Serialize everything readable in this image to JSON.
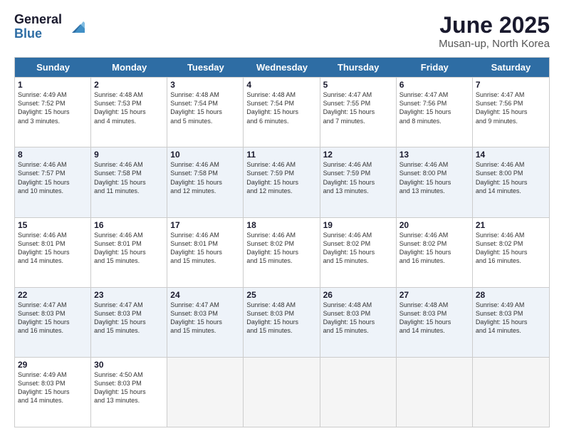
{
  "logo": {
    "general": "General",
    "blue": "Blue"
  },
  "title": "June 2025",
  "location": "Musan-up, North Korea",
  "days": [
    "Sunday",
    "Monday",
    "Tuesday",
    "Wednesday",
    "Thursday",
    "Friday",
    "Saturday"
  ],
  "rows": [
    [
      {
        "day": "1",
        "lines": [
          "Sunrise: 4:49 AM",
          "Sunset: 7:52 PM",
          "Daylight: 15 hours",
          "and 3 minutes."
        ]
      },
      {
        "day": "2",
        "lines": [
          "Sunrise: 4:48 AM",
          "Sunset: 7:53 PM",
          "Daylight: 15 hours",
          "and 4 minutes."
        ]
      },
      {
        "day": "3",
        "lines": [
          "Sunrise: 4:48 AM",
          "Sunset: 7:54 PM",
          "Daylight: 15 hours",
          "and 5 minutes."
        ]
      },
      {
        "day": "4",
        "lines": [
          "Sunrise: 4:48 AM",
          "Sunset: 7:54 PM",
          "Daylight: 15 hours",
          "and 6 minutes."
        ]
      },
      {
        "day": "5",
        "lines": [
          "Sunrise: 4:47 AM",
          "Sunset: 7:55 PM",
          "Daylight: 15 hours",
          "and 7 minutes."
        ]
      },
      {
        "day": "6",
        "lines": [
          "Sunrise: 4:47 AM",
          "Sunset: 7:56 PM",
          "Daylight: 15 hours",
          "and 8 minutes."
        ]
      },
      {
        "day": "7",
        "lines": [
          "Sunrise: 4:47 AM",
          "Sunset: 7:56 PM",
          "Daylight: 15 hours",
          "and 9 minutes."
        ]
      }
    ],
    [
      {
        "day": "8",
        "lines": [
          "Sunrise: 4:46 AM",
          "Sunset: 7:57 PM",
          "Daylight: 15 hours",
          "and 10 minutes."
        ]
      },
      {
        "day": "9",
        "lines": [
          "Sunrise: 4:46 AM",
          "Sunset: 7:58 PM",
          "Daylight: 15 hours",
          "and 11 minutes."
        ]
      },
      {
        "day": "10",
        "lines": [
          "Sunrise: 4:46 AM",
          "Sunset: 7:58 PM",
          "Daylight: 15 hours",
          "and 12 minutes."
        ]
      },
      {
        "day": "11",
        "lines": [
          "Sunrise: 4:46 AM",
          "Sunset: 7:59 PM",
          "Daylight: 15 hours",
          "and 12 minutes."
        ]
      },
      {
        "day": "12",
        "lines": [
          "Sunrise: 4:46 AM",
          "Sunset: 7:59 PM",
          "Daylight: 15 hours",
          "and 13 minutes."
        ]
      },
      {
        "day": "13",
        "lines": [
          "Sunrise: 4:46 AM",
          "Sunset: 8:00 PM",
          "Daylight: 15 hours",
          "and 13 minutes."
        ]
      },
      {
        "day": "14",
        "lines": [
          "Sunrise: 4:46 AM",
          "Sunset: 8:00 PM",
          "Daylight: 15 hours",
          "and 14 minutes."
        ]
      }
    ],
    [
      {
        "day": "15",
        "lines": [
          "Sunrise: 4:46 AM",
          "Sunset: 8:01 PM",
          "Daylight: 15 hours",
          "and 14 minutes."
        ]
      },
      {
        "day": "16",
        "lines": [
          "Sunrise: 4:46 AM",
          "Sunset: 8:01 PM",
          "Daylight: 15 hours",
          "and 15 minutes."
        ]
      },
      {
        "day": "17",
        "lines": [
          "Sunrise: 4:46 AM",
          "Sunset: 8:01 PM",
          "Daylight: 15 hours",
          "and 15 minutes."
        ]
      },
      {
        "day": "18",
        "lines": [
          "Sunrise: 4:46 AM",
          "Sunset: 8:02 PM",
          "Daylight: 15 hours",
          "and 15 minutes."
        ]
      },
      {
        "day": "19",
        "lines": [
          "Sunrise: 4:46 AM",
          "Sunset: 8:02 PM",
          "Daylight: 15 hours",
          "and 15 minutes."
        ]
      },
      {
        "day": "20",
        "lines": [
          "Sunrise: 4:46 AM",
          "Sunset: 8:02 PM",
          "Daylight: 15 hours",
          "and 16 minutes."
        ]
      },
      {
        "day": "21",
        "lines": [
          "Sunrise: 4:46 AM",
          "Sunset: 8:02 PM",
          "Daylight: 15 hours",
          "and 16 minutes."
        ]
      }
    ],
    [
      {
        "day": "22",
        "lines": [
          "Sunrise: 4:47 AM",
          "Sunset: 8:03 PM",
          "Daylight: 15 hours",
          "and 16 minutes."
        ]
      },
      {
        "day": "23",
        "lines": [
          "Sunrise: 4:47 AM",
          "Sunset: 8:03 PM",
          "Daylight: 15 hours",
          "and 15 minutes."
        ]
      },
      {
        "day": "24",
        "lines": [
          "Sunrise: 4:47 AM",
          "Sunset: 8:03 PM",
          "Daylight: 15 hours",
          "and 15 minutes."
        ]
      },
      {
        "day": "25",
        "lines": [
          "Sunrise: 4:48 AM",
          "Sunset: 8:03 PM",
          "Daylight: 15 hours",
          "and 15 minutes."
        ]
      },
      {
        "day": "26",
        "lines": [
          "Sunrise: 4:48 AM",
          "Sunset: 8:03 PM",
          "Daylight: 15 hours",
          "and 15 minutes."
        ]
      },
      {
        "day": "27",
        "lines": [
          "Sunrise: 4:48 AM",
          "Sunset: 8:03 PM",
          "Daylight: 15 hours",
          "and 14 minutes."
        ]
      },
      {
        "day": "28",
        "lines": [
          "Sunrise: 4:49 AM",
          "Sunset: 8:03 PM",
          "Daylight: 15 hours",
          "and 14 minutes."
        ]
      }
    ],
    [
      {
        "day": "29",
        "lines": [
          "Sunrise: 4:49 AM",
          "Sunset: 8:03 PM",
          "Daylight: 15 hours",
          "and 14 minutes."
        ]
      },
      {
        "day": "30",
        "lines": [
          "Sunrise: 4:50 AM",
          "Sunset: 8:03 PM",
          "Daylight: 15 hours",
          "and 13 minutes."
        ]
      },
      {
        "day": "",
        "lines": []
      },
      {
        "day": "",
        "lines": []
      },
      {
        "day": "",
        "lines": []
      },
      {
        "day": "",
        "lines": []
      },
      {
        "day": "",
        "lines": []
      }
    ]
  ],
  "altRows": [
    1,
    3
  ]
}
